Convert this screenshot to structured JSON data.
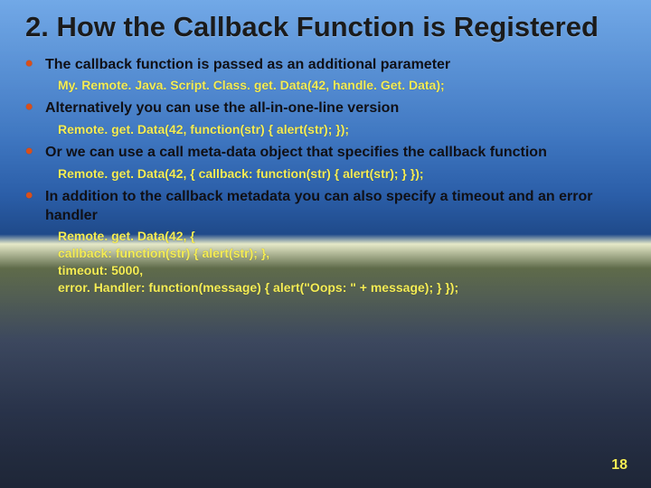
{
  "title": "2. How the Callback Function is Registered",
  "bullets": [
    {
      "text": "The callback function is passed as an additional parameter",
      "code": "My. Remote. Java. Script. Class. get. Data(42, handle. Get. Data);"
    },
    {
      "text": "Alternatively you can use the all-in-one-line version",
      "code": "Remote. get. Data(42, function(str) { alert(str); });"
    },
    {
      "text": "Or we can use a call meta-data object that specifies the callback function",
      "code": "Remote. get. Data(42, { callback: function(str) { alert(str); } });"
    },
    {
      "text": "In addition to the callback metadata you can also specify a timeout and an error handler",
      "code": "Remote. get. Data(42, {\ncallback: function(str) { alert(str); },\ntimeout: 5000,\nerror. Handler: function(message) { alert(\"Oops: \" + message); } });"
    }
  ],
  "page_number": "18"
}
